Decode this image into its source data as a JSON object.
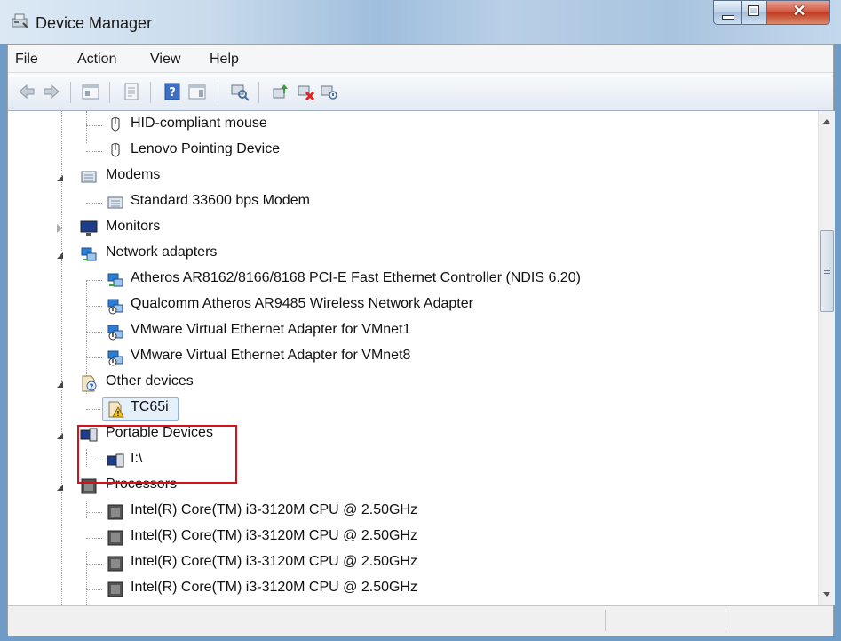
{
  "window": {
    "title": "Device Manager",
    "close_glyph": "✕"
  },
  "menu": [
    "File",
    "Action",
    "View",
    "Help"
  ],
  "toolbar": {
    "icons": [
      "back-icon",
      "forward-icon",
      "show-hide-tree-icon",
      "properties-icon",
      "help-icon",
      "action-pane-icon",
      "scan-hardware-icon",
      "update-driver-icon",
      "uninstall-icon",
      "disable-icon"
    ]
  },
  "tree": {
    "items": [
      {
        "label": "HID-compliant mouse",
        "level": 2,
        "icon": "mouse-icon"
      },
      {
        "label": "Lenovo Pointing Device",
        "level": 2,
        "icon": "mouse-icon"
      },
      {
        "label": "Modems",
        "level": 1,
        "icon": "modem-icon",
        "expanded": true
      },
      {
        "label": "Standard 33600 bps Modem",
        "level": 2,
        "icon": "modem-icon"
      },
      {
        "label": "Monitors",
        "level": 1,
        "icon": "monitor-icon",
        "expanded": false
      },
      {
        "label": "Network adapters",
        "level": 1,
        "icon": "network-icon",
        "expanded": true
      },
      {
        "label": "Atheros AR8162/8166/8168 PCI-E Fast Ethernet Controller (NDIS 6.20)",
        "level": 2,
        "icon": "network-icon"
      },
      {
        "label": "Qualcomm Atheros AR9485 Wireless Network Adapter",
        "level": 2,
        "icon": "network-disabled-icon"
      },
      {
        "label": "VMware Virtual Ethernet Adapter for VMnet1",
        "level": 2,
        "icon": "network-disabled-icon"
      },
      {
        "label": "VMware Virtual Ethernet Adapter for VMnet8",
        "level": 2,
        "icon": "network-disabled-icon"
      },
      {
        "label": "Other devices",
        "level": 1,
        "icon": "unknown-device-icon",
        "expanded": true
      },
      {
        "label": "TC65i",
        "level": 2,
        "icon": "warning-device-icon",
        "selected": true
      },
      {
        "label": "Portable Devices",
        "level": 1,
        "icon": "portable-device-icon",
        "expanded": true
      },
      {
        "label": "I:\\",
        "level": 2,
        "icon": "portable-device-icon"
      },
      {
        "label": "Processors",
        "level": 1,
        "icon": "processor-icon",
        "expanded": true
      },
      {
        "label": "Intel(R) Core(TM) i3-3120M CPU @ 2.50GHz",
        "level": 2,
        "icon": "processor-icon"
      },
      {
        "label": "Intel(R) Core(TM) i3-3120M CPU @ 2.50GHz",
        "level": 2,
        "icon": "processor-icon"
      },
      {
        "label": "Intel(R) Core(TM) i3-3120M CPU @ 2.50GHz",
        "level": 2,
        "icon": "processor-icon"
      },
      {
        "label": "Intel(R) Core(TM) i3-3120M CPU @ 2.50GHz",
        "level": 2,
        "icon": "processor-icon"
      }
    ]
  },
  "colors": {
    "highlight": "#d4121b",
    "selection": "#e6f0fb"
  }
}
